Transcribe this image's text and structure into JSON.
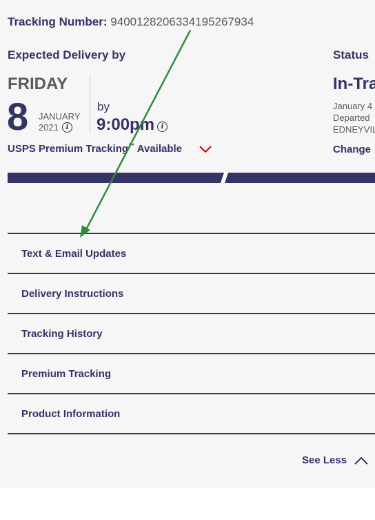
{
  "tracking": {
    "label": "Tracking Number:",
    "number": "9400128206334195267934"
  },
  "expected": {
    "heading": "Expected Delivery by",
    "day": "FRIDAY",
    "date": "8",
    "month": "JANUARY",
    "year": "2021",
    "by_label": "by",
    "time": "9:00pm",
    "info_icon": "info-icon"
  },
  "status": {
    "heading": "Status",
    "value": "In-Tra",
    "details": [
      "January 4",
      "Departed",
      "EDNEYVIL"
    ],
    "link": "Change"
  },
  "premium": {
    "text": "USPS Premium Tracking",
    "tm": "™",
    "suffix": "Available",
    "icon": "chevron-down-icon",
    "icon_color": "#cc0000"
  },
  "accordion": {
    "items": [
      {
        "label": "Text & Email Updates"
      },
      {
        "label": "Delivery Instructions"
      },
      {
        "label": "Tracking History"
      },
      {
        "label": "Premium Tracking"
      },
      {
        "label": "Product Information"
      }
    ]
  },
  "footer": {
    "see_less_label": "See Less",
    "icon": "chevron-up-icon"
  },
  "colors": {
    "primary": "#333366",
    "annotation_arrow": "#2e8b3e",
    "accent_red": "#cc0000",
    "panel_bg": "#f6f6f6"
  }
}
